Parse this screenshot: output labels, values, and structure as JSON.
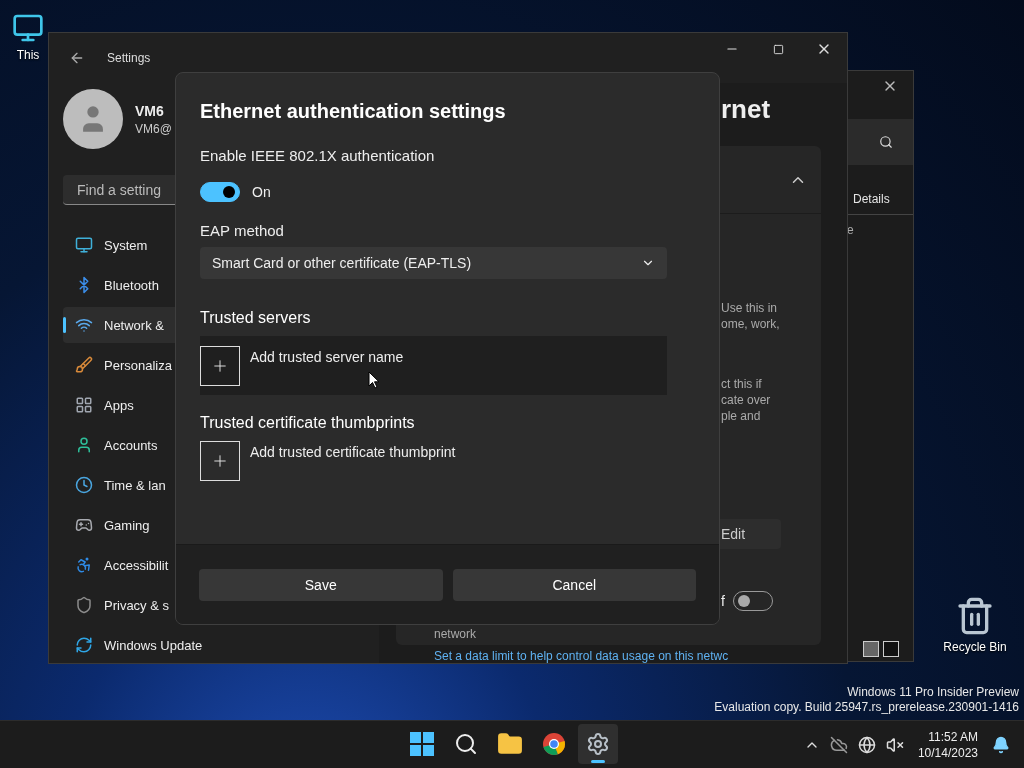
{
  "desktop_icons": [
    {
      "kind": "computer",
      "label": "This"
    },
    {
      "kind": "recycle",
      "label": "Recycle Bin"
    }
  ],
  "background_window": {
    "tab": "Details",
    "column_fragment": "e"
  },
  "settings": {
    "title": "Settings",
    "user": {
      "name": "VM6",
      "email": "VM6@"
    },
    "search": {
      "placeholder": "Find a setting"
    },
    "nav": [
      {
        "kind": "system",
        "label": "System",
        "selected": false
      },
      {
        "kind": "bluetooth",
        "label": "Bluetooth",
        "selected": false
      },
      {
        "kind": "network",
        "label": "Network &",
        "selected": true
      },
      {
        "kind": "personalization",
        "label": "Personaliza",
        "selected": false
      },
      {
        "kind": "apps",
        "label": "Apps",
        "selected": false
      },
      {
        "kind": "accounts",
        "label": "Accounts",
        "selected": false
      },
      {
        "kind": "time",
        "label": "Time & lan",
        "selected": false
      },
      {
        "kind": "gaming",
        "label": "Gaming",
        "selected": false
      },
      {
        "kind": "accessibility",
        "label": "Accessibilit",
        "selected": false
      },
      {
        "kind": "privacy",
        "label": "Privacy & s",
        "selected": false
      },
      {
        "kind": "update",
        "label": "Windows Update",
        "selected": false
      }
    ],
    "page": {
      "heading": "rnet",
      "description_1": [
        "Use this in",
        "ome, work,"
      ],
      "description_2": [
        "ct this if",
        "cate over",
        "ple and"
      ],
      "edit_button": "Edit",
      "toggle_label": "f",
      "toggle_on": false,
      "line": "network",
      "data_limit_text": "Set a data limit to help control data usage on this netwc"
    }
  },
  "dialog": {
    "title": "Ethernet authentication settings",
    "ieee_label": "Enable IEEE 802.1X authentication",
    "ieee_toggle": {
      "on": true,
      "label": "On"
    },
    "eap_label": "EAP method",
    "eap_value": "Smart Card or other certificate (EAP-TLS)",
    "sections": [
      {
        "heading": "Trusted servers",
        "add_label": "Add trusted server name",
        "highlighted": true
      },
      {
        "heading": "Trusted certificate thumbprints",
        "add_label": "Add trusted certificate thumbprint",
        "highlighted": false
      }
    ],
    "buttons": [
      {
        "label": "Save"
      },
      {
        "label": "Cancel"
      }
    ]
  },
  "system_notice": [
    "Windows 11 Pro Insider Preview",
    "Evaluation copy. Build 25947.rs_prerelease.230901-1416"
  ],
  "taskbar": {
    "apps": [
      {
        "kind": "start",
        "selected": false
      },
      {
        "kind": "search",
        "selected": false
      },
      {
        "kind": "explorer",
        "selected": false
      },
      {
        "kind": "browser",
        "selected": false
      },
      {
        "kind": "settings",
        "selected": true
      }
    ],
    "clock": {
      "time": "11:52 AM",
      "date": "10/14/2023"
    }
  }
}
